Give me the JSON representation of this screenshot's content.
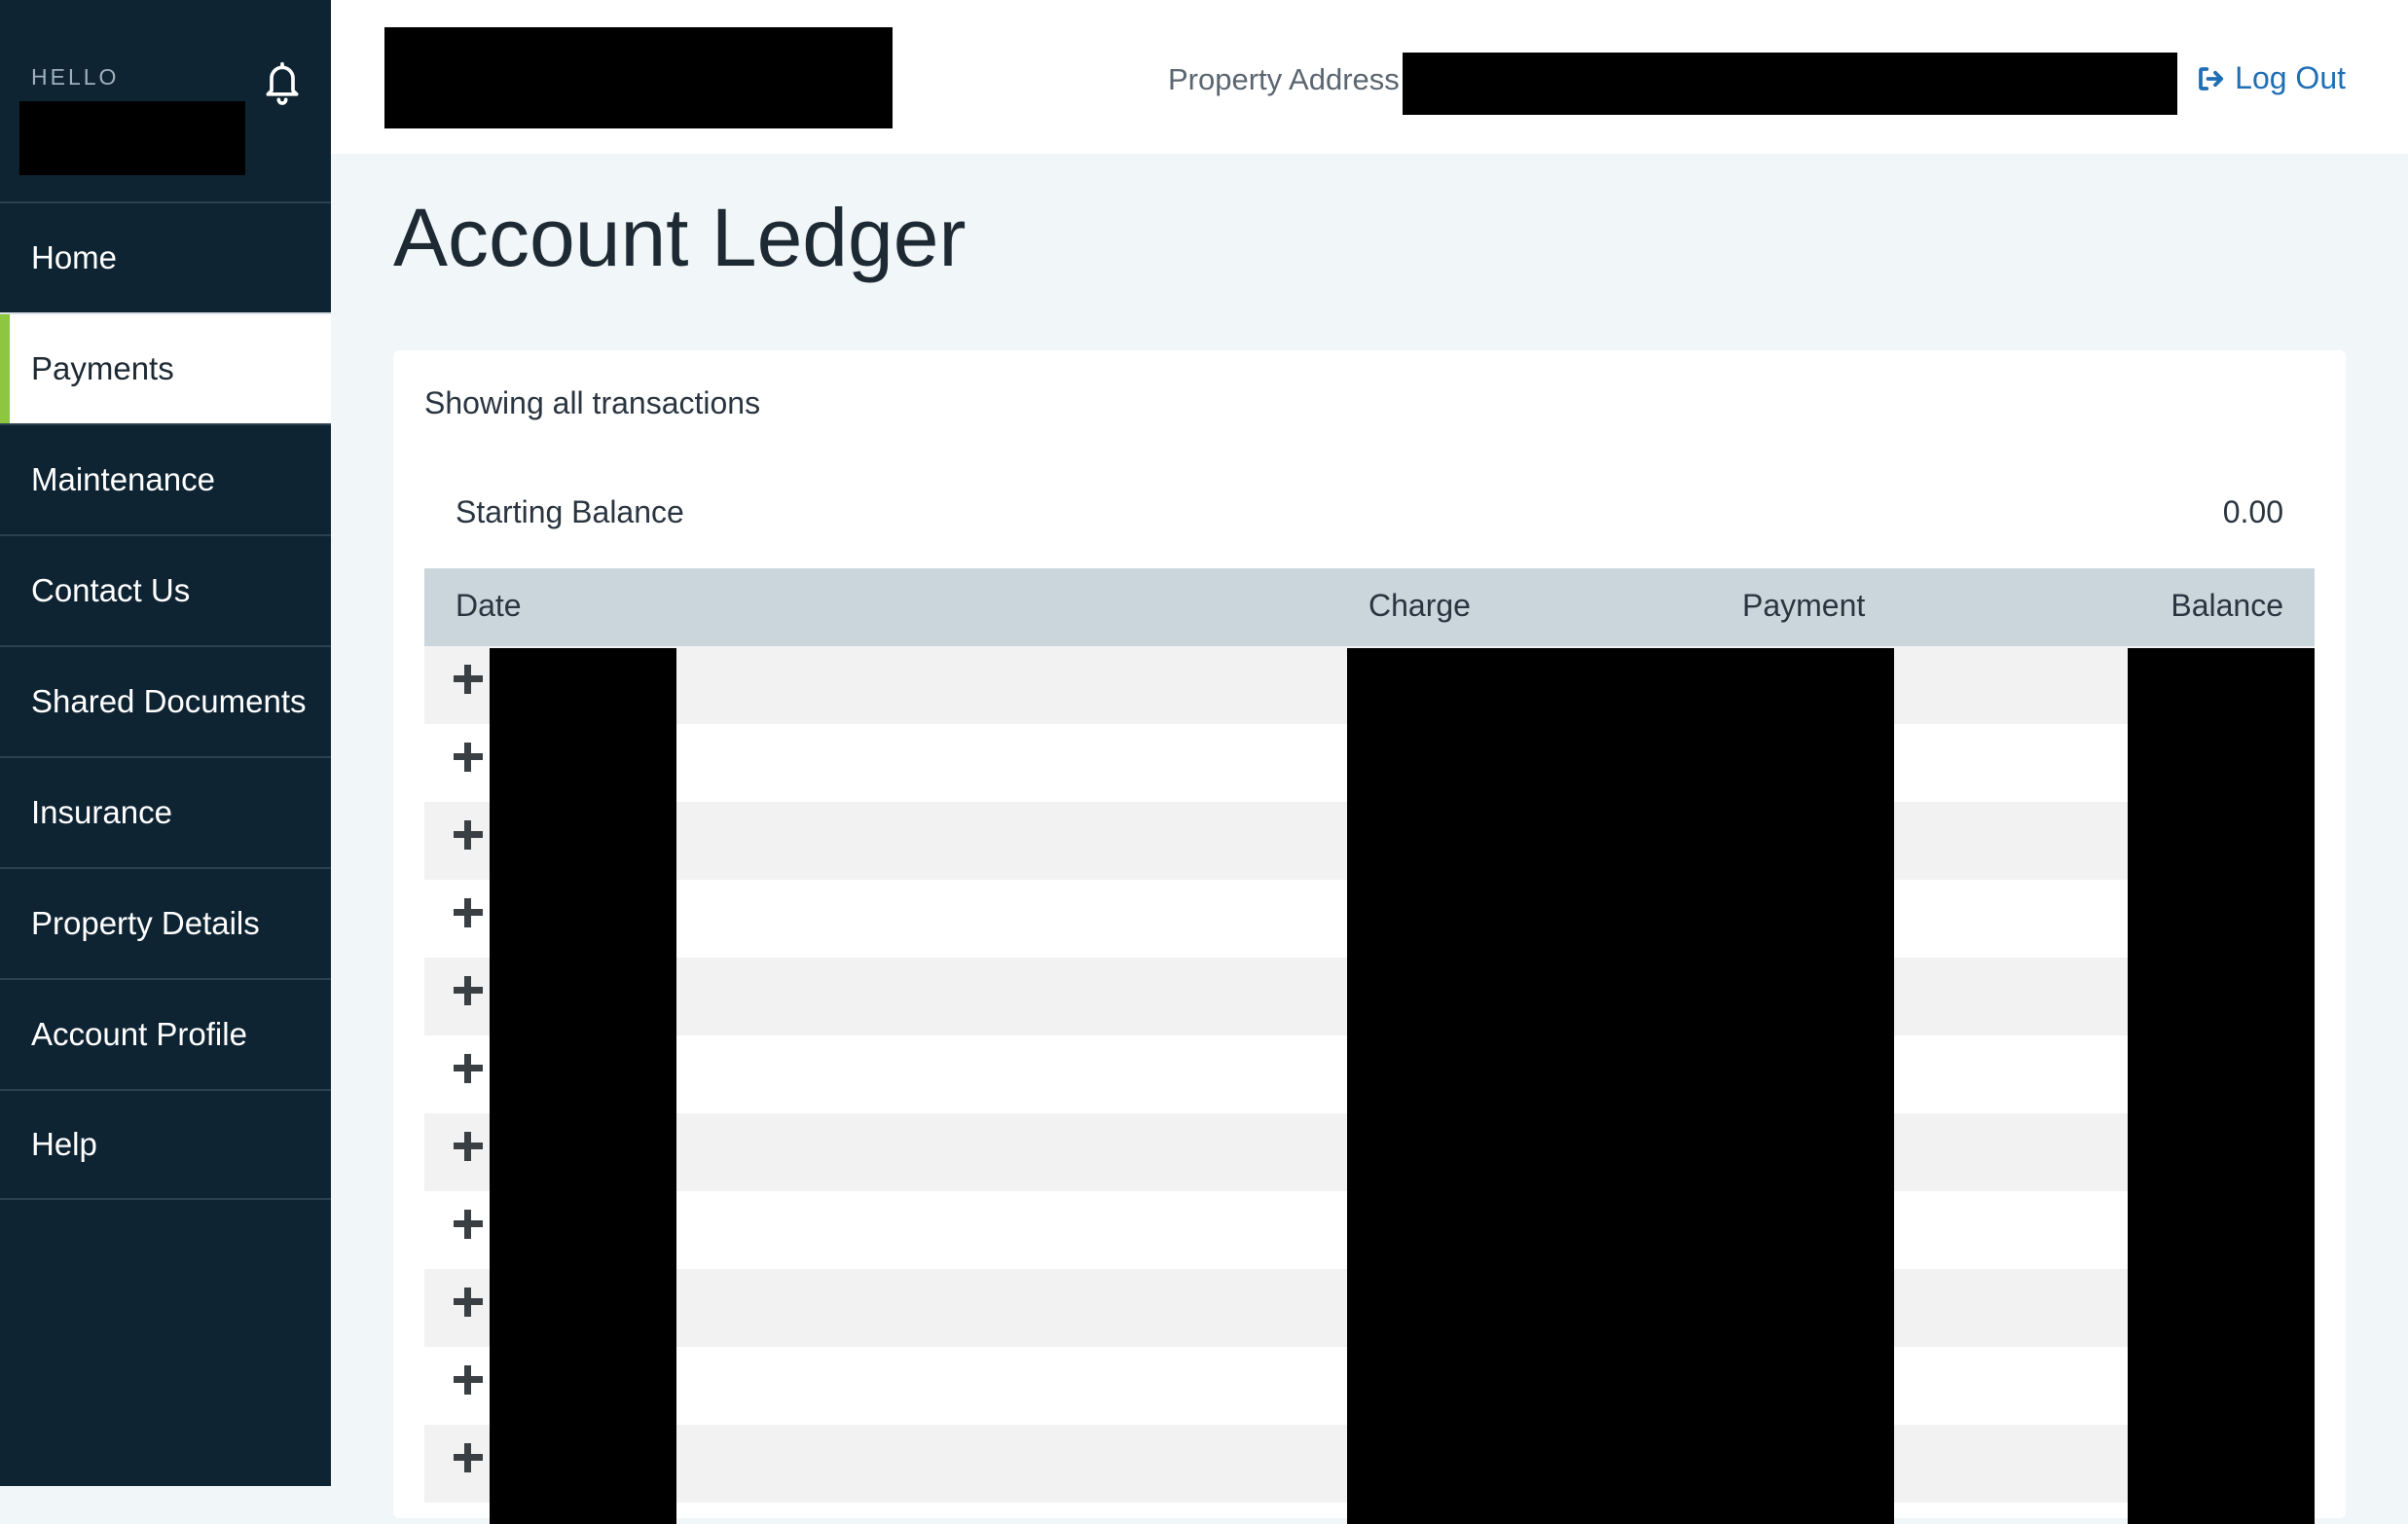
{
  "sidebar": {
    "greeting": "HELLO",
    "icon": "bell-icon",
    "items": [
      {
        "label": "Home"
      },
      {
        "label": "Payments",
        "active": true
      },
      {
        "label": "Maintenance"
      },
      {
        "label": "Contact Us"
      },
      {
        "label": "Shared Documents"
      },
      {
        "label": "Insurance"
      },
      {
        "label": "Property Details"
      },
      {
        "label": "Account Profile"
      },
      {
        "label": "Help"
      }
    ]
  },
  "header": {
    "property_label": "Property Address",
    "logout_label": "Log Out",
    "logout_icon": "sign-out-icon"
  },
  "main": {
    "title": "Account Ledger",
    "filter_text": "Showing all transactions",
    "starting_balance_label": "Starting Balance",
    "starting_balance_value": "0.00",
    "columns": [
      "Date",
      "Charge",
      "Payment",
      "Balance"
    ],
    "row_count": 11,
    "row_icon": "plus-icon"
  },
  "colors": {
    "sidebar_bg": "#0f2433",
    "active_accent": "#8dc63f",
    "link": "#1f6fb5",
    "table_header_bg": "#cbd5dc"
  }
}
